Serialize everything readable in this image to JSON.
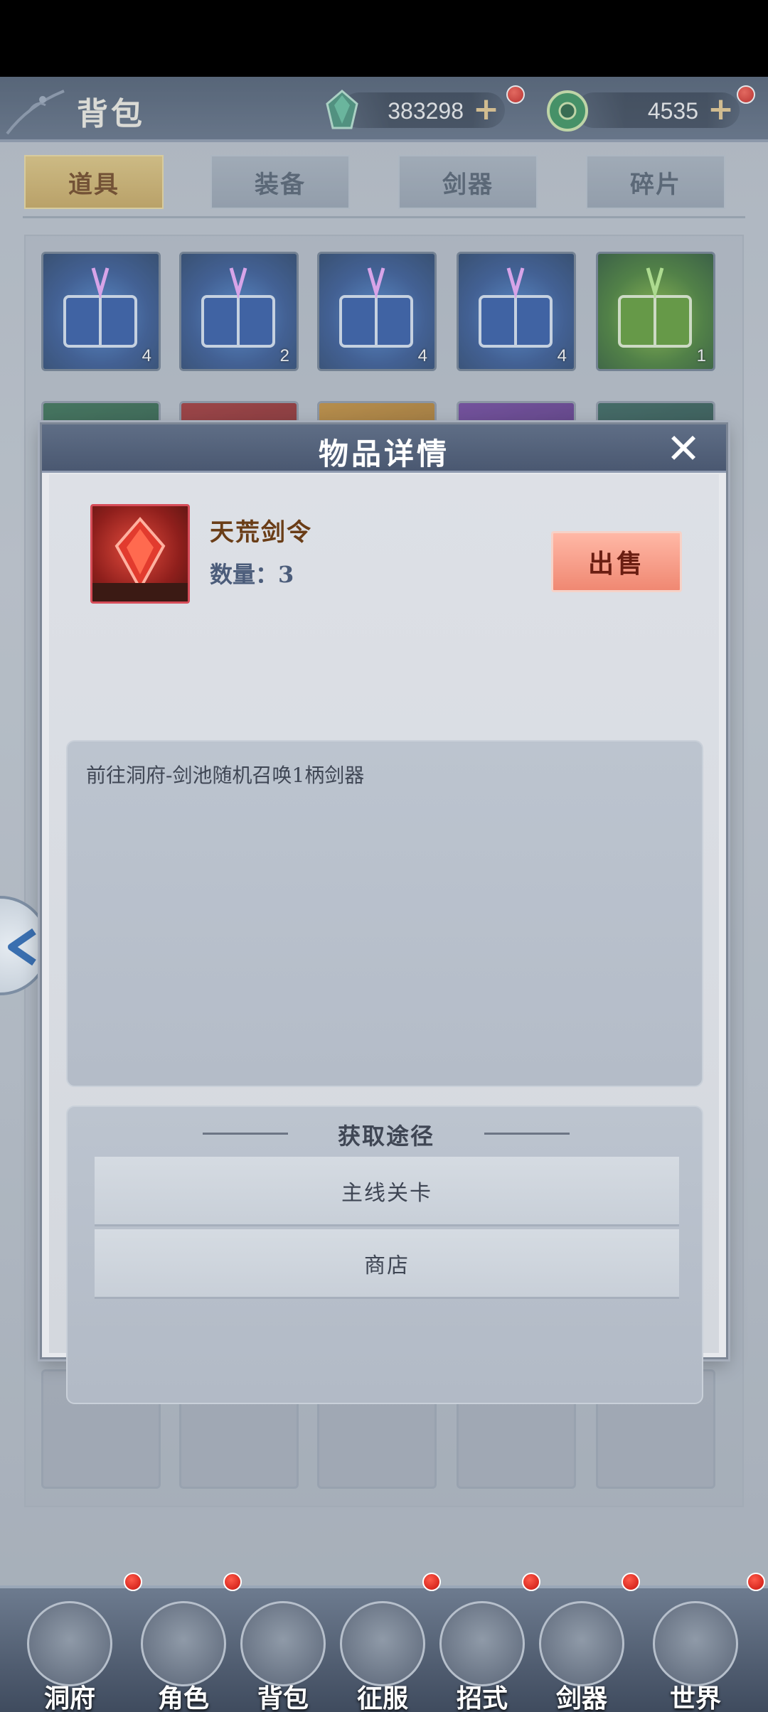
{
  "header": {
    "title": "背包",
    "currencies": [
      {
        "icon": "jade-crystal-icon",
        "value": "383298",
        "plus": "+"
      },
      {
        "icon": "spirit-coin-icon",
        "value": "4535",
        "plus": "+"
      }
    ]
  },
  "tabs": [
    {
      "label": "道具",
      "active": true
    },
    {
      "label": "装备",
      "active": false
    },
    {
      "label": "剑器",
      "active": false
    },
    {
      "label": "碎片",
      "active": false
    }
  ],
  "inventory": {
    "row1": [
      {
        "icon": "blue-scroll-book-icon",
        "count": "4"
      },
      {
        "icon": "blue-scroll-book-icon",
        "count": "2"
      },
      {
        "icon": "blue-scroll-book-icon",
        "count": "4"
      },
      {
        "icon": "blue-scroll-book-icon",
        "count": "4"
      },
      {
        "icon": "green-scroll-book-icon",
        "count": "1"
      }
    ]
  },
  "modal": {
    "title": "物品详情",
    "close": "✕",
    "item": {
      "name": "天荒剑令",
      "quantity_text": "数量：3",
      "icon": "red-sword-token-icon"
    },
    "sell_label": "出售",
    "description": "前往洞府-剑池随机召唤1柄剑器",
    "source": {
      "title": "获取途径",
      "items": [
        "主线关卡",
        "商店"
      ]
    }
  },
  "bottom_nav": [
    {
      "label": "洞府",
      "icon": "cave-mansion-icon"
    },
    {
      "label": "角色",
      "icon": "character-icon"
    },
    {
      "label": "背包",
      "icon": "backpack-icon"
    },
    {
      "label": "征服",
      "icon": "crossed-swords-icon"
    },
    {
      "label": "招式",
      "icon": "scroll-icon"
    },
    {
      "label": "剑器",
      "icon": "sword-icon"
    },
    {
      "label": "世界",
      "icon": "world-map-icon"
    }
  ],
  "colors": {
    "active_tab": "#c9a556",
    "sell_button": "#f08872",
    "notification": "#c8140e"
  }
}
